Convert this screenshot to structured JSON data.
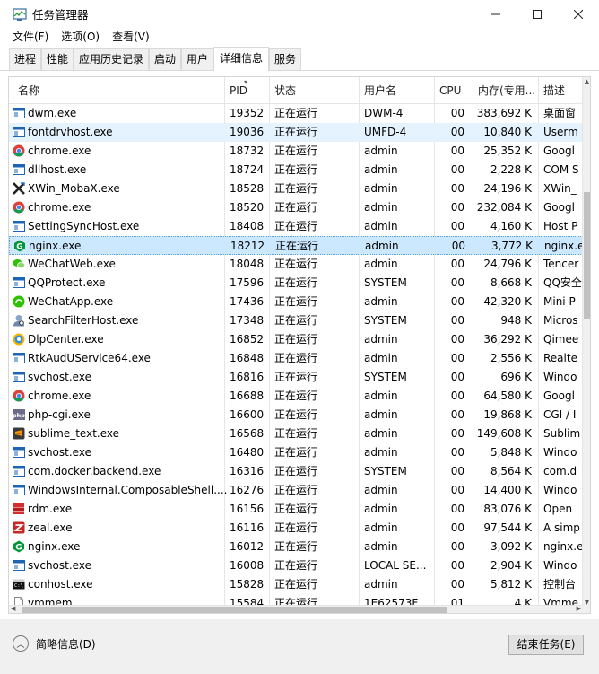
{
  "window": {
    "title": "任务管理器",
    "minimize_glyph": "—",
    "maximize_glyph": "☐",
    "close_glyph": "✕"
  },
  "menu": [
    "文件(F)",
    "选项(O)",
    "查看(V)"
  ],
  "tabs": [
    "进程",
    "性能",
    "应用历史记录",
    "启动",
    "用户",
    "详细信息",
    "服务"
  ],
  "active_tab": "详细信息",
  "columns": {
    "name": "名称",
    "pid": "PID",
    "status": "状态",
    "user": "用户名",
    "cpu": "CPU",
    "memory": "内存(专用...",
    "description": "描述"
  },
  "processes": [
    {
      "name": "dwm.exe",
      "pid": "19352",
      "status": "正在运行",
      "user": "DWM-4",
      "cpu": "00",
      "memory": "383,692 K",
      "description": "桌面窗",
      "icon": "window-icon"
    },
    {
      "name": "fontdrvhost.exe",
      "pid": "19036",
      "status": "正在运行",
      "user": "UMFD-4",
      "cpu": "00",
      "memory": "10,840 K",
      "description": "Userm",
      "icon": "window-icon"
    },
    {
      "name": "chrome.exe",
      "pid": "18732",
      "status": "正在运行",
      "user": "admin",
      "cpu": "00",
      "memory": "25,352 K",
      "description": "Googl",
      "icon": "chrome-icon"
    },
    {
      "name": "dllhost.exe",
      "pid": "18724",
      "status": "正在运行",
      "user": "admin",
      "cpu": "00",
      "memory": "2,228 K",
      "description": "COM S",
      "icon": "window-icon"
    },
    {
      "name": "XWin_MobaX.exe",
      "pid": "18528",
      "status": "正在运行",
      "user": "admin",
      "cpu": "00",
      "memory": "24,196 K",
      "description": "XWin_",
      "icon": "xwin-icon"
    },
    {
      "name": "chrome.exe",
      "pid": "18520",
      "status": "正在运行",
      "user": "admin",
      "cpu": "00",
      "memory": "232,084 K",
      "description": "Googl",
      "icon": "chrome-icon"
    },
    {
      "name": "SettingSyncHost.exe",
      "pid": "18408",
      "status": "正在运行",
      "user": "admin",
      "cpu": "00",
      "memory": "4,160 K",
      "description": "Host P",
      "icon": "window-icon"
    },
    {
      "name": "nginx.exe",
      "pid": "18212",
      "status": "正在运行",
      "user": "admin",
      "cpu": "00",
      "memory": "3,772 K",
      "description": "nginx.e",
      "icon": "nginx-icon"
    },
    {
      "name": "WeChatWeb.exe",
      "pid": "18048",
      "status": "正在运行",
      "user": "admin",
      "cpu": "00",
      "memory": "24,796 K",
      "description": "Tencer",
      "icon": "wechat-icon"
    },
    {
      "name": "QQProtect.exe",
      "pid": "17596",
      "status": "正在运行",
      "user": "SYSTEM",
      "cpu": "00",
      "memory": "8,668 K",
      "description": "QQ安全",
      "icon": "window-icon"
    },
    {
      "name": "WeChatApp.exe",
      "pid": "17436",
      "status": "正在运行",
      "user": "admin",
      "cpu": "00",
      "memory": "42,320 K",
      "description": "Mini P",
      "icon": "wechatapp-icon"
    },
    {
      "name": "SearchFilterHost.exe",
      "pid": "17348",
      "status": "正在运行",
      "user": "SYSTEM",
      "cpu": "00",
      "memory": "948 K",
      "description": "Micros",
      "icon": "search-host-icon"
    },
    {
      "name": "DlpCenter.exe",
      "pid": "16852",
      "status": "正在运行",
      "user": "admin",
      "cpu": "00",
      "memory": "36,292 K",
      "description": "Qimee",
      "icon": "dlp-icon"
    },
    {
      "name": "RtkAudUService64.exe",
      "pid": "16848",
      "status": "正在运行",
      "user": "admin",
      "cpu": "00",
      "memory": "2,556 K",
      "description": "Realte",
      "icon": "window-icon"
    },
    {
      "name": "svchost.exe",
      "pid": "16816",
      "status": "正在运行",
      "user": "SYSTEM",
      "cpu": "00",
      "memory": "696 K",
      "description": "Windo",
      "icon": "window-icon"
    },
    {
      "name": "chrome.exe",
      "pid": "16688",
      "status": "正在运行",
      "user": "admin",
      "cpu": "00",
      "memory": "64,580 K",
      "description": "Googl",
      "icon": "chrome-icon"
    },
    {
      "name": "php-cgi.exe",
      "pid": "16600",
      "status": "正在运行",
      "user": "admin",
      "cpu": "00",
      "memory": "19,868 K",
      "description": "CGI / I",
      "icon": "php-icon"
    },
    {
      "name": "sublime_text.exe",
      "pid": "16568",
      "status": "正在运行",
      "user": "admin",
      "cpu": "00",
      "memory": "149,608 K",
      "description": "Sublim",
      "icon": "sublime-icon"
    },
    {
      "name": "svchost.exe",
      "pid": "16480",
      "status": "正在运行",
      "user": "admin",
      "cpu": "00",
      "memory": "5,848 K",
      "description": "Windo",
      "icon": "window-icon"
    },
    {
      "name": "com.docker.backend.exe",
      "pid": "16316",
      "status": "正在运行",
      "user": "SYSTEM",
      "cpu": "00",
      "memory": "8,564 K",
      "description": "com.d",
      "icon": "window-icon"
    },
    {
      "name": "WindowsInternal.ComposableShell....",
      "pid": "16276",
      "status": "正在运行",
      "user": "admin",
      "cpu": "00",
      "memory": "14,400 K",
      "description": "Windo",
      "icon": "window-icon"
    },
    {
      "name": "rdm.exe",
      "pid": "16156",
      "status": "正在运行",
      "user": "admin",
      "cpu": "00",
      "memory": "83,076 K",
      "description": "Open",
      "icon": "rdm-icon"
    },
    {
      "name": "zeal.exe",
      "pid": "16116",
      "status": "正在运行",
      "user": "admin",
      "cpu": "00",
      "memory": "97,544 K",
      "description": "A simp",
      "icon": "zeal-icon"
    },
    {
      "name": "nginx.exe",
      "pid": "16012",
      "status": "正在运行",
      "user": "admin",
      "cpu": "00",
      "memory": "3,092 K",
      "description": "nginx.e",
      "icon": "nginx-icon"
    },
    {
      "name": "svchost.exe",
      "pid": "16008",
      "status": "正在运行",
      "user": "LOCAL SE...",
      "cpu": "00",
      "memory": "2,904 K",
      "description": "Windo",
      "icon": "window-icon"
    },
    {
      "name": "conhost.exe",
      "pid": "15828",
      "status": "正在运行",
      "user": "admin",
      "cpu": "00",
      "memory": "5,812 K",
      "description": "控制台",
      "icon": "console-icon"
    },
    {
      "name": "vmmem",
      "pid": "15584",
      "status": "正在运行",
      "user": "1E62573F...",
      "cpu": "01",
      "memory": "4 K",
      "description": "Vmme",
      "icon": "blank-file-icon"
    }
  ],
  "hover_row_index": 1,
  "selected_row_index": 7,
  "footer": {
    "fewer_details": "简略信息(D)",
    "end_task": "结束任务(E)"
  },
  "colors": {
    "selected_row": "#cce8ff",
    "hover_row": "#e5f3ff",
    "window_icon_blue": "#1e64b4",
    "chrome_red": "#db4437",
    "chrome_green": "#0f9d58",
    "chrome_yellow": "#f4b400",
    "nginx_green": "#009639",
    "wechat_green": "#2dc100",
    "sublime_orange": "#ff9800",
    "rdm_red": "#d32f2f",
    "zeal_red": "#c62828"
  }
}
